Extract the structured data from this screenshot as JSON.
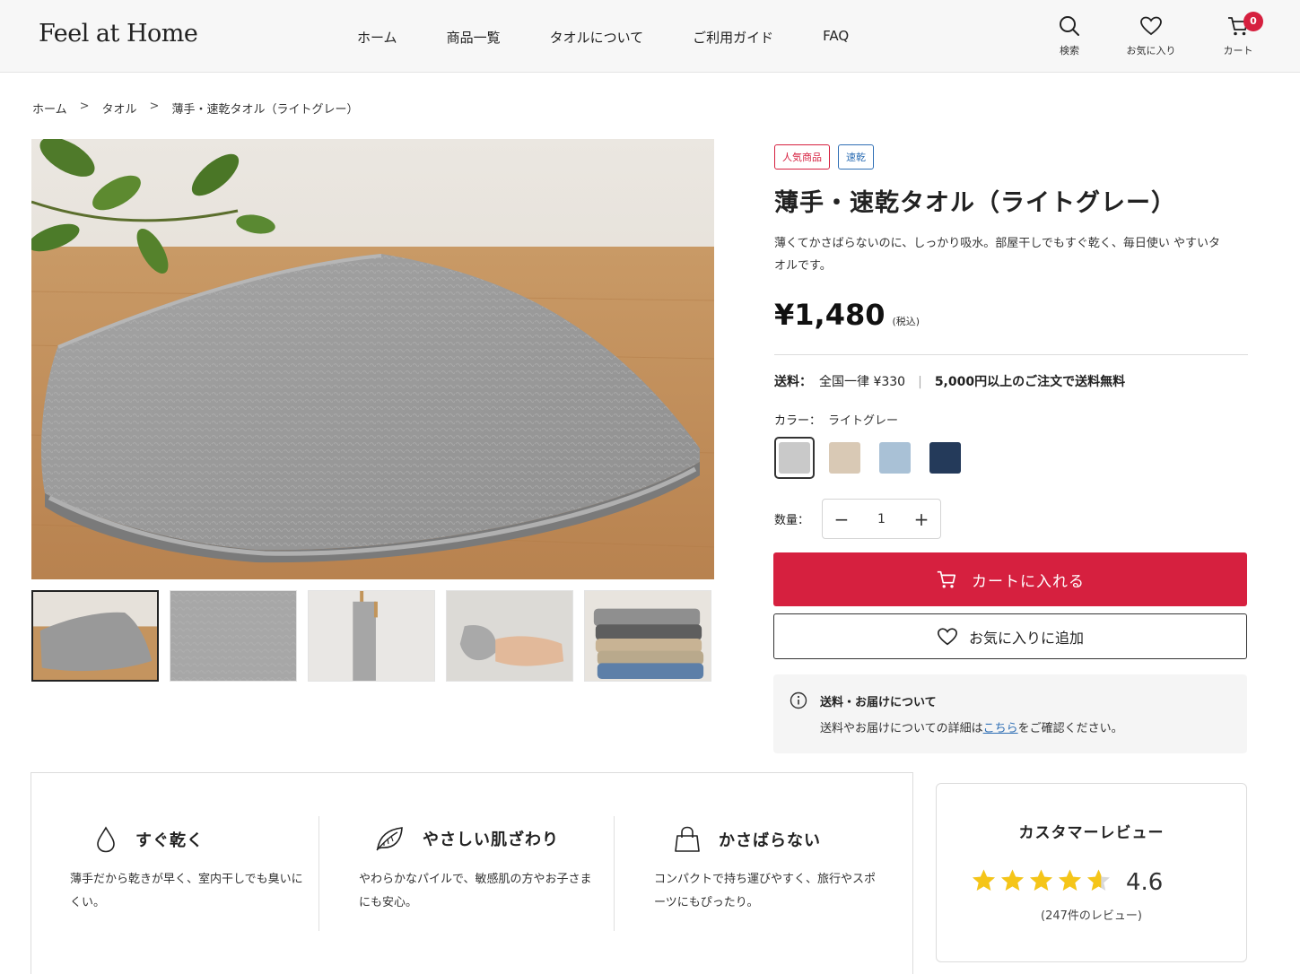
{
  "header": {
    "logo": "Feel at Home",
    "nav": [
      "ホーム",
      "商品一覧",
      "タオルについて",
      "ご利用ガイド",
      "FAQ"
    ],
    "search_label": "検索",
    "favorites_label": "お気に入り",
    "cart_label": "カート",
    "cart_count": "0"
  },
  "breadcrumb": [
    "ホーム",
    "タオル",
    "薄手・速乾タオル（ライトグレー）"
  ],
  "breadcrumb_sep": ">",
  "product": {
    "badges": [
      "人気商品",
      "速乾"
    ],
    "title": "薄手・速乾タオル（ライトグレー）",
    "description": "薄くてかさばらないのに、しっかり吸水。部屋干しでもすぐ乾く、毎日使い やすいタオルです。",
    "price": "¥1,480",
    "tax_note": "(税込)",
    "shipping_label": "送料：",
    "shipping_value": "全国一律 ¥330",
    "shipping_free": "5,000円以上のご注文で送料無料",
    "color_label": "カラー：",
    "color_value": "ライトグレー",
    "colors": [
      "#c9c9c9",
      "#d9c9b5",
      "#a9c1d6",
      "#243a5a"
    ],
    "qty_label": "数量：",
    "qty": "1",
    "add_to_cart": "カートに入れる",
    "add_to_fav": "お気に入りに追加",
    "info_title": "送料・お届けについて",
    "info_pre": "送料やお届けについての詳細は",
    "info_link": "こちら",
    "info_post": "をご確認ください。"
  },
  "features": [
    {
      "icon": "water-drop-icon",
      "title": "すぐ乾く",
      "desc": "薄手だから乾きが早く、室内干しでも臭いにくい。"
    },
    {
      "icon": "leaf-icon",
      "title": "やさしい肌ざわり",
      "desc": "やわらかなパイルで、敏感肌の方やお子さまにも安心。"
    },
    {
      "icon": "bag-icon",
      "title": "かさばらない",
      "desc": "コンパクトで持ち運びやすく、旅行やスポーツにもぴったり。"
    }
  ],
  "review": {
    "title": "カスタマーレビュー",
    "rating": "4.6",
    "count": "(247件のレビュー)",
    "star_color": "#f5c518"
  },
  "colors": {
    "accent": "#d6203f",
    "link": "#2f6fb5"
  }
}
